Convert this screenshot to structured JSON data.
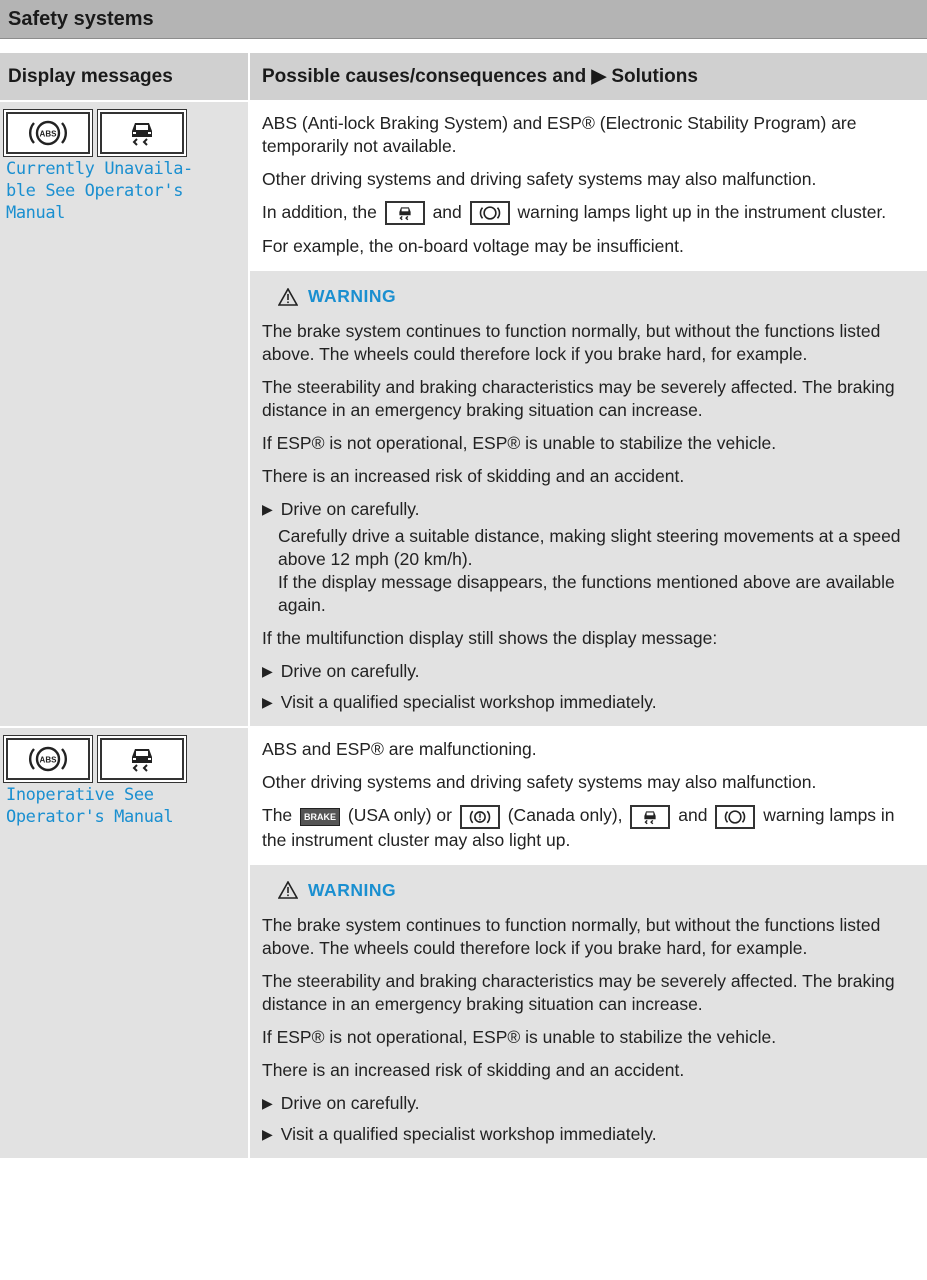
{
  "section_title": "Safety systems",
  "columns": {
    "left": "Display messages",
    "right": "Possible causes/consequences and ▶ Solutions"
  },
  "icons": {
    "abs": "abs-icon",
    "esp": "esp-skid-icon",
    "brake": "brake-icon",
    "brake_canada": "brake-circle-icon",
    "warning": "warning-triangle-icon"
  },
  "colors": {
    "accent": "#1a8fd0",
    "header_bg": "#b4b4b4",
    "cell_bg": "#e2e2e2"
  },
  "rows": [
    {
      "message": "Currently Unavaila-\nble See Operator's\nManual",
      "intro": [
        "ABS (Anti-lock Braking System) and ESP® (Electronic Stability Program) are temporarily not available.",
        "Other driving systems and driving safety systems may also malfunction."
      ],
      "lamp_text_a": "In addition, the",
      "lamp_text_b": "and",
      "lamp_text_c": "warning lamps light up in the instrument cluster.",
      "example": "For example, the on-board voltage may be insufficient.",
      "warning_label": "WARNING",
      "warning": [
        "The brake system continues to function normally, but without the functions listed above. The wheels could therefore lock if you brake hard, for example.",
        "The steerability and braking characteristics may be severely affected. The braking distance in an emergency braking situation can increase.",
        "If ESP® is not operational, ESP® is unable to stabilize the vehicle.",
        "There is an increased risk of skidding and an accident."
      ],
      "bullet1": "Drive on carefully.",
      "bullet1_sub": [
        "Carefully drive a suitable distance, making slight steering movements at a speed above 12 mph (20 km/h).",
        "If the display message disappears, the functions mentioned above are available again."
      ],
      "after": "If the multifunction display still shows the display message:",
      "bullet2": "Drive on carefully.",
      "bullet3": "Visit a qualified specialist workshop immediately."
    },
    {
      "message": "Inoperative See\nOperator's Manual",
      "intro": [
        "ABS and ESP® are malfunctioning.",
        "Other driving systems and driving safety systems may also malfunction."
      ],
      "lamp_text_a": "The",
      "brake_label": "BRAKE",
      "lamp_text_b": "(USA only) or",
      "lamp_text_c": "(Canada only),",
      "lamp_text_d": "and",
      "lamp_text_e": "warning lamps in the instrument cluster may also light up.",
      "warning_label": "WARNING",
      "warning": [
        "The brake system continues to function normally, but without the functions listed above. The wheels could therefore lock if you brake hard, for example.",
        "The steerability and braking characteristics may be severely affected. The braking distance in an emergency braking situation can increase.",
        "If ESP® is not operational, ESP® is unable to stabilize the vehicle.",
        "There is an increased risk of skidding and an accident."
      ],
      "bullet1": "Drive on carefully.",
      "bullet2": "Visit a qualified specialist workshop immediately."
    }
  ]
}
